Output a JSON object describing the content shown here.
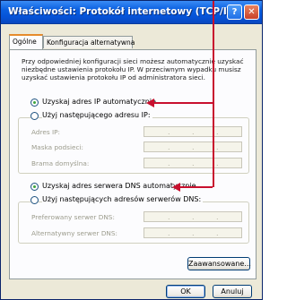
{
  "window": {
    "title": "Właściwości: Protokół internetowy (TCP/IP)",
    "help_glyph": "?",
    "close_glyph": "✕"
  },
  "tabs": [
    "Ogólne",
    "Konfiguracja alternatywna"
  ],
  "description": "Przy odpowiedniej konfiguracji sieci możesz automatycznie uzyskać niezbędne ustawienia protokołu IP. W przeciwnym wypadku musisz uzyskać ustawienia protokołu IP od administratora sieci.",
  "ip": {
    "auto_label": "Uzyskaj adres IP automatycznie",
    "manual_label": "Użyj następującego adresu IP:",
    "selected": "auto",
    "fields": [
      {
        "label": "Adres IP:"
      },
      {
        "label": "Maska podsieci:"
      },
      {
        "label": "Brama domyślna:"
      }
    ]
  },
  "dns": {
    "auto_label": "Uzyskaj adres serwera DNS automatycznie",
    "manual_label": "Użyj następujących adresów serwerów DNS:",
    "selected": "auto",
    "fields": [
      {
        "label": "Preferowany serwer DNS:"
      },
      {
        "label": "Alternatywny serwer DNS:"
      }
    ]
  },
  "buttons": {
    "advanced": "Zaawansowane...",
    "ok": "OK",
    "cancel": "Anuluj"
  },
  "colors": {
    "annotation_arrow": "#c8102e",
    "titlebar": "#0553d8"
  }
}
